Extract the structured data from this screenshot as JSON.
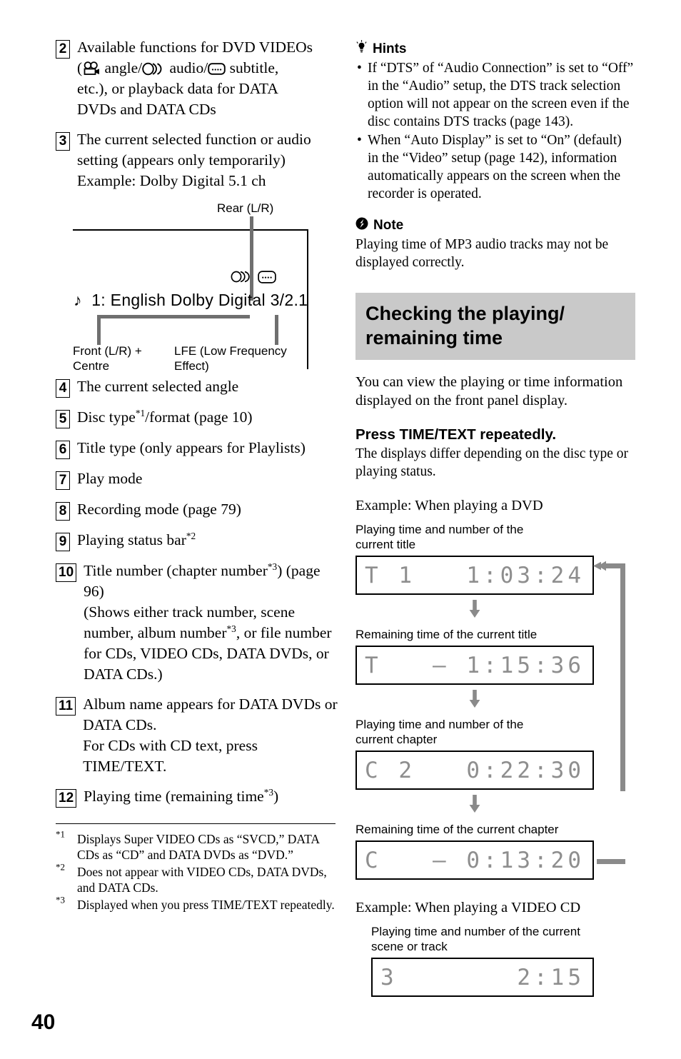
{
  "page_number": "40",
  "left_column": {
    "numbered_items": [
      {
        "num": "2",
        "segments": [
          {
            "t": "text",
            "v": "Available functions for DVD VIDEOs ("
          },
          {
            "t": "icon",
            "v": "angle-icon"
          },
          {
            "t": "text",
            "v": " angle/"
          },
          {
            "t": "icon",
            "v": "audio-icon"
          },
          {
            "t": "text",
            "v": " audio/"
          },
          {
            "t": "icon",
            "v": "subtitle-icon"
          },
          {
            "t": "text",
            "v": " subtitle, etc.), or playback data for DATA DVDs and DATA CDs"
          }
        ],
        "plain": "Available functions for DVD VIDEOs ( angle/ audio/ subtitle, etc.), or playback data for DATA DVDs and DATA CDs"
      },
      {
        "num": "3",
        "line1": "The current selected function or audio setting (appears only temporarily)",
        "line2": "Example: Dolby Digital 5.1 ch"
      },
      {
        "num": "4",
        "text": "The current selected angle"
      },
      {
        "num": "5",
        "text_a": "Disc type",
        "sup": "*1",
        "text_b": "/format (page 10)"
      },
      {
        "num": "6",
        "text": "Title type (only appears for Playlists)"
      },
      {
        "num": "7",
        "text": "Play mode"
      },
      {
        "num": "8",
        "text": "Recording mode (page 79)"
      },
      {
        "num": "9",
        "text_a": "Playing status bar",
        "sup": "*2"
      },
      {
        "num": "10",
        "text_a": "Title number (chapter number",
        "sup1": "*3",
        "text_b": ") (page 96)",
        "text_c": "(Shows either track number, scene number, album number",
        "sup2": "*3",
        "text_d": ", or file number for CDs, VIDEO CDs, DATA DVDs, or DATA CDs.)"
      },
      {
        "num": "11",
        "line1": "Album name appears for DATA DVDs or DATA CDs.",
        "line2": "For CDs with CD text, press TIME/TEXT."
      },
      {
        "num": "12",
        "text_a": "Playing time (remaining time",
        "sup": "*3",
        "text_b": ")"
      }
    ],
    "diagram": {
      "label_rear": "Rear (L/R)",
      "main_text": "1:  English Dolby Digital 3/2.1",
      "note_glyph": "♪",
      "label_front_line1": "Front (L/R) +",
      "label_front_line2": "Centre",
      "label_lfe_line1": "LFE (Low Frequency",
      "label_lfe_line2": "Effect)"
    },
    "footnotes": [
      {
        "mark": "*1",
        "text": "Displays Super VIDEO CDs as “SVCD,” DATA CDs as “CD” and DATA DVDs as “DVD.”"
      },
      {
        "mark": "*2",
        "text": "Does not appear with VIDEO CDs, DATA DVDs, and DATA CDs."
      },
      {
        "mark": "*3",
        "text": "Displayed when you press TIME/TEXT repeatedly."
      }
    ]
  },
  "right_column": {
    "hints": {
      "icon": "lightbulb-icon",
      "title": "Hints",
      "items": [
        "If “DTS” of “Audio Connection” is set to “Off” in the “Audio” setup, the DTS track selection option will not appear on the screen even if the disc contains DTS tracks (page 143).",
        "When “Auto Display” is set to “On” (default) in the “Video” setup (page 142), information automatically appears on the screen when the recorder is operated."
      ]
    },
    "note": {
      "icon": "note-exclamation-icon",
      "title": "Note",
      "text": "Playing time of MP3 audio tracks may not be displayed correctly."
    },
    "section": {
      "banner_line1": "Checking the playing/",
      "banner_line2": "remaining time",
      "intro": "You can view the playing or time information displayed on the front panel display.",
      "press_heading": "Press TIME/TEXT repeatedly.",
      "press_body": "The displays differ depending on the disc type or playing status."
    },
    "dvd_example": {
      "heading": "Example: When playing a DVD",
      "steps": [
        {
          "caption_line1": "Playing time and number of the",
          "caption_line2": "current title",
          "lcd_left": "T 1",
          "lcd_right": "1:03:24"
        },
        {
          "caption_line1": "Remaining time of the current title",
          "caption_line2": "",
          "lcd_left": "T",
          "lcd_right": "– 1:15:36"
        },
        {
          "caption_line1": "Playing time and number of the",
          "caption_line2": "current chapter",
          "lcd_left": "C 2",
          "lcd_right": "0:22:30"
        },
        {
          "caption_line1": "Remaining time of the current chapter",
          "caption_line2": "",
          "lcd_left": "C",
          "lcd_right": "– 0:13:20"
        }
      ]
    },
    "videocd_example": {
      "heading": "Example: When playing a VIDEO CD",
      "caption_line1": "Playing time and number of the current",
      "caption_line2": "scene or track",
      "lcd_left": "3",
      "lcd_right": "2:15"
    }
  },
  "colors": {
    "banner_bg": "#c9c9c9",
    "connector_gray": "#6f6f6f",
    "lcd_segment": "#8e8e8e",
    "loop_arrow": "#8a8a8a"
  }
}
